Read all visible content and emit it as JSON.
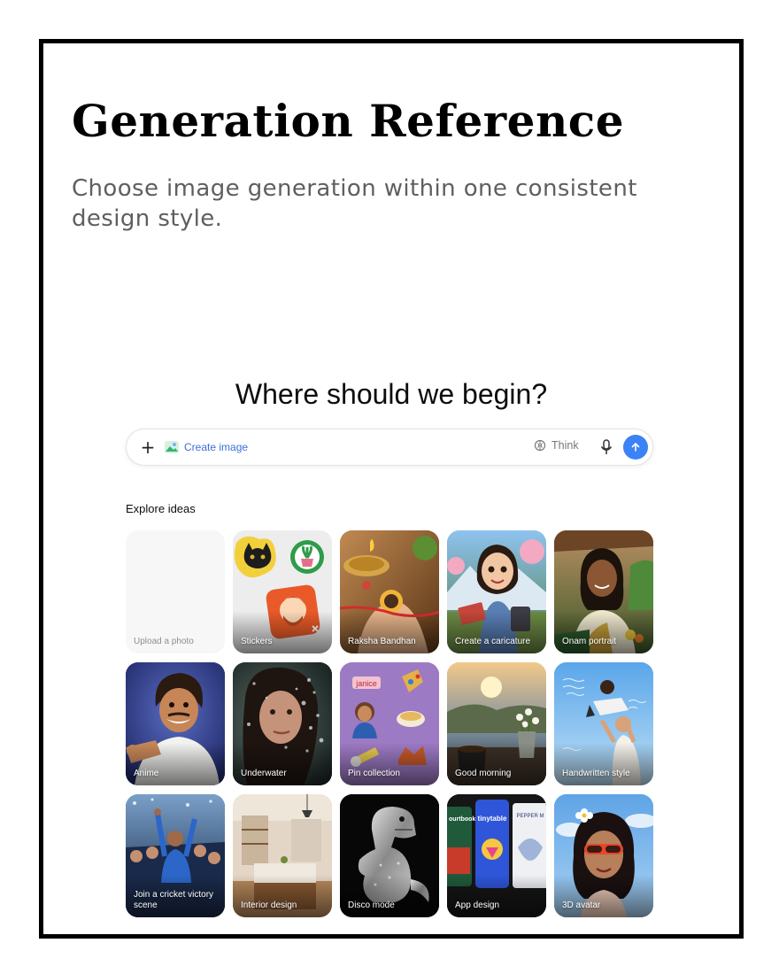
{
  "title": "Generation Reference",
  "subtitle": "Choose image generation within one consistent design style.",
  "heading": "Where should we begin?",
  "composer": {
    "create_label": "Create image",
    "think_label": "Think",
    "accent": "#3b82f6",
    "link_color": "#3d6fd9"
  },
  "explore_label": "Explore ideas",
  "cards": [
    {
      "label": "Upload a photo"
    },
    {
      "label": "Stickers"
    },
    {
      "label": "Raksha Bandhan"
    },
    {
      "label": "Create a caricature"
    },
    {
      "label": "Onam portrait"
    },
    {
      "label": "Anime"
    },
    {
      "label": "Underwater"
    },
    {
      "label": "Pin collection"
    },
    {
      "label": "Good morning"
    },
    {
      "label": "Handwritten style"
    },
    {
      "label": "Join a cricket victory scene"
    },
    {
      "label": "Interior design"
    },
    {
      "label": "Disco mode"
    },
    {
      "label": "App design"
    },
    {
      "label": "3D avatar"
    }
  ],
  "stickers": {
    "pin_tag": "janice"
  },
  "app_design_tags": [
    "ourtbook",
    "tinytable",
    "PEPPER M"
  ]
}
